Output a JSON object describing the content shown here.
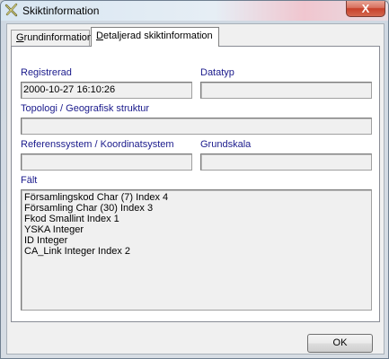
{
  "window": {
    "title": "Skiktinformation",
    "close_glyph": "X",
    "icon": "tool-cross-icon"
  },
  "tabs": [
    {
      "label_prefix": "",
      "label_accel": "G",
      "label_rest": "rundinformation",
      "active": false
    },
    {
      "label_prefix": "",
      "label_accel": "D",
      "label_rest": "etaljerad skiktinformation",
      "active": true
    }
  ],
  "fields": {
    "registrerad": {
      "label": "Registrerad",
      "value": "2000-10-27 16:10:26"
    },
    "datatyp": {
      "label": "Datatyp",
      "value": ""
    },
    "topologi": {
      "label": "Topologi / Geografisk struktur",
      "value": ""
    },
    "referenssystem": {
      "label": "Referenssystem / Koordinatsystem",
      "value": ""
    },
    "grundskala": {
      "label": "Grundskala",
      "value": ""
    },
    "falt": {
      "label": "Fält",
      "items": [
        "Församlingskod Char (7) Index 4",
        "Församling Char (30) Index 3",
        "Fkod Smallint Index 1",
        "YSKA Integer",
        "ID Integer",
        "CA_Link Integer Index 2"
      ]
    }
  },
  "buttons": {
    "ok": "OK"
  }
}
